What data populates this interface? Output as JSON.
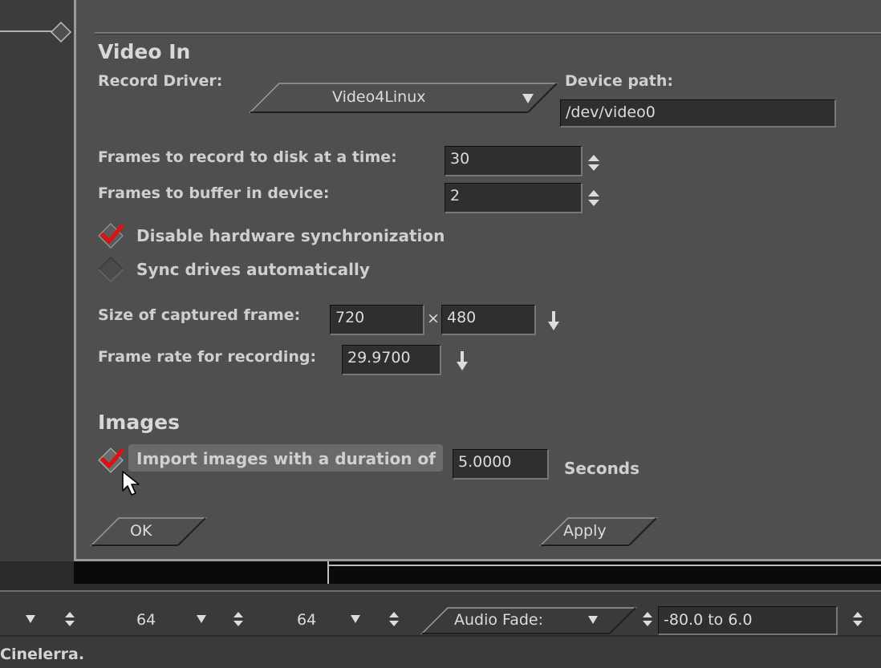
{
  "dialog": {
    "video_in": {
      "heading": "Video In",
      "record_driver_label": "Record Driver:",
      "record_driver_value": "Video4Linux",
      "device_path_label": "Device path:",
      "device_path_value": "/dev/video0",
      "frames_to_disk_label": "Frames to record to disk at a time:",
      "frames_to_disk_value": "30",
      "frames_to_buffer_label": "Frames to buffer in device:",
      "frames_to_buffer_value": "2",
      "disable_hw_sync_label": "Disable hardware synchronization",
      "disable_hw_sync_checked": true,
      "sync_drives_label": "Sync drives automatically",
      "sync_drives_checked": false,
      "capture_size_label": "Size of captured frame:",
      "capture_width": "720",
      "capture_times": "×",
      "capture_height": "480",
      "frame_rate_label": "Frame rate for recording:",
      "frame_rate_value": "29.9700"
    },
    "images": {
      "heading": "Images",
      "import_label": "Import images with a duration of",
      "import_checked": true,
      "duration_value": "5.0000",
      "seconds_label": "Seconds"
    },
    "ok_label": "OK",
    "apply_label": "Apply"
  },
  "bottom_bar": {
    "value_1": "64",
    "value_2": "64",
    "audio_fade_label": "Audio Fade:",
    "fade_range_value": "-80.0 to 6.0"
  },
  "status_bar": {
    "text": "Cinelerra."
  },
  "colors": {
    "dialog_bg": "#4f4f4f",
    "check_red": "#e01010",
    "field_bg": "#2f2f2f"
  }
}
